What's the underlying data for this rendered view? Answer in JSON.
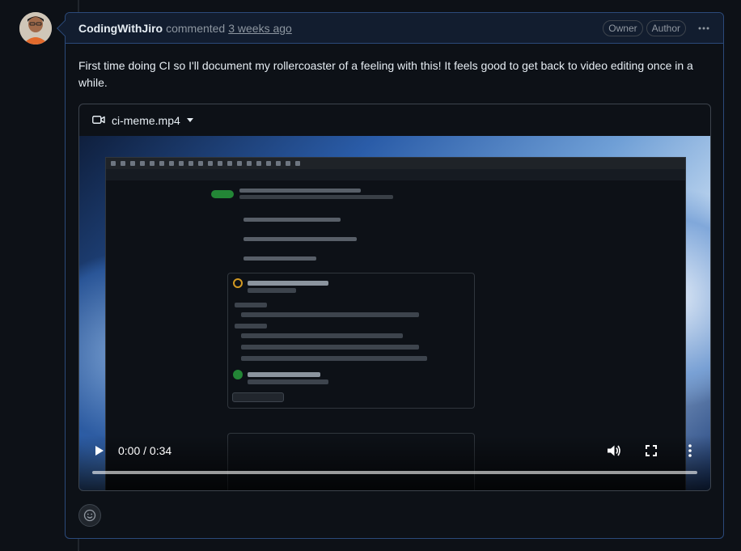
{
  "comment": {
    "author": "CodingWithJiro",
    "action": "commented",
    "time": "3 weeks ago",
    "badges": [
      "Owner",
      "Author"
    ],
    "more_icon": "kebab-horizontal-icon",
    "body": "First time doing CI so I'll document my rollercoaster of a feeling with this! It feels good to get back to video editing once in a while."
  },
  "attachment": {
    "filename": "ci-meme.mp4",
    "icon": "video-icon"
  },
  "video": {
    "timecode": "0:00 / 0:34",
    "progress": 0,
    "icons": {
      "play": "play-icon",
      "volume": "volume-icon",
      "fullscreen": "fullscreen-icon",
      "more": "kebab-vertical-icon"
    }
  },
  "reaction": {
    "icon": "smiley-icon"
  },
  "colors": {
    "background": "#0d1117",
    "header_bg": "#121d2f",
    "border_accent": "#2b4a7a",
    "text": "#e6edf3",
    "muted": "#8d96a0"
  }
}
